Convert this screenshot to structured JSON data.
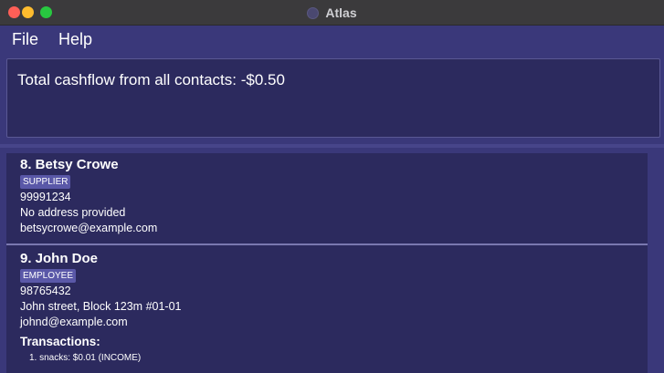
{
  "window": {
    "title": "Atlas"
  },
  "menu": {
    "items": [
      "File",
      "Help"
    ]
  },
  "result": {
    "text": "Total cashflow from all contacts: -$0.50"
  },
  "contacts": [
    {
      "heading": "8. Betsy Crowe",
      "tag": "SUPPLIER",
      "phone": "99991234",
      "address": "No address provided",
      "email": "betsycrowe@example.com"
    },
    {
      "heading": "9. John Doe",
      "tag": "EMPLOYEE",
      "phone": "98765432",
      "address": "John street, Block 123m #01-01",
      "email": "johnd@example.com",
      "transactions_label": "Transactions:",
      "transactions": [
        "1. snacks: $0.01 (INCOME)"
      ]
    }
  ]
}
